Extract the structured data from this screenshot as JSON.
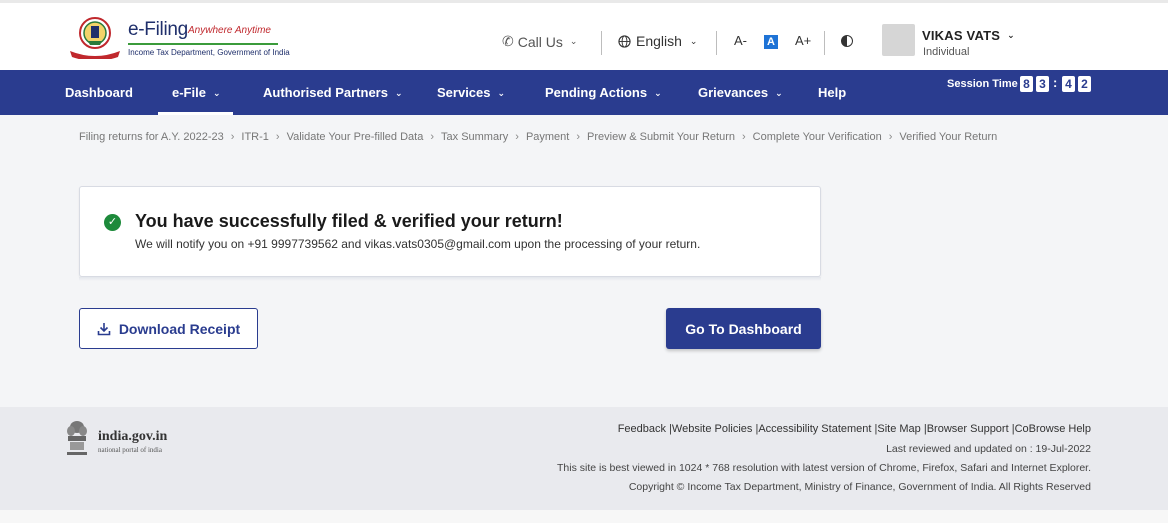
{
  "header": {
    "logo_title": "e-Filing",
    "logo_tagline": "Anywhere Anytime",
    "logo_dept": "Income Tax Department, Government of India",
    "call_us": "Call Us",
    "language": "English",
    "font_decrease": "A-",
    "font_default": "A",
    "font_increase": "A+",
    "user_name": "VIKAS VATS",
    "user_role": "Individual"
  },
  "nav": {
    "items": [
      {
        "label": "Dashboard"
      },
      {
        "label": "e-File"
      },
      {
        "label": "Authorised Partners"
      },
      {
        "label": "Services"
      },
      {
        "label": "Pending Actions"
      },
      {
        "label": "Grievances"
      },
      {
        "label": "Help"
      }
    ],
    "session_label": "Session Time",
    "session_digits": [
      "8",
      "3",
      "4",
      "2"
    ]
  },
  "breadcrumb": [
    "Filing returns for A.Y. 2022-23",
    "ITR-1",
    "Validate Your Pre-filled Data",
    "Tax Summary",
    "Payment",
    "Preview & Submit Your Return",
    "Complete Your Verification",
    "Verified Your Return"
  ],
  "success": {
    "headline": "You have successfully filed & verified your return!",
    "message": "We will notify you on +91 9997739562 and vikas.vats0305@gmail.com upon the processing of your return."
  },
  "actions": {
    "download_receipt": "Download Receipt",
    "go_dashboard": "Go To Dashboard"
  },
  "footer": {
    "portal_name": "india.gov.in",
    "portal_sub": "national portal of india",
    "links": [
      "Feedback",
      "Website Policies",
      "Accessibility Statement",
      "Site Map",
      "Browser Support",
      "CoBrowse Help"
    ],
    "last_reviewed": "Last reviewed and updated on : 19-Jul-2022",
    "best_viewed": "This site is best viewed in 1024 * 768 resolution with latest version of Chrome, Firefox, Safari and Internet Explorer.",
    "copyright": "Copyright © Income Tax Department, Ministry of Finance, Government of India. All Rights Reserved"
  }
}
